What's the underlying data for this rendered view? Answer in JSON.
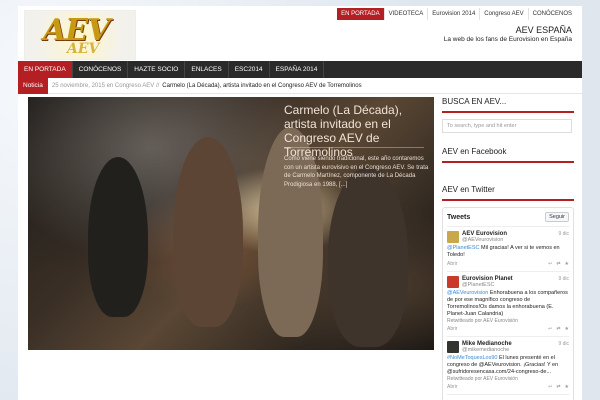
{
  "topnav": [
    "EN PORTADA",
    "VIDEOTECA",
    "Eurovision 2014",
    "Congreso AEV",
    "CONÓCENOS"
  ],
  "logo": {
    "text": "AEV",
    "subtext": "AEV"
  },
  "site": {
    "title": "AEV ESPAÑA",
    "description": "La web de los fans de Eurovision en España"
  },
  "mainnav": [
    "EN PORTADA",
    "CONÓCENOS",
    "HAZTE SOCIO",
    "ENLACES",
    "ESC2014",
    "ESPAÑA 2014"
  ],
  "ticker": {
    "label": "Noticia",
    "meta": "25 noviembre, 2015 en Congreso AEV //",
    "title": "Carmelo (La Década), artista invitado en el Congreso AEV de Torremolinos"
  },
  "feature": {
    "title": "Carmelo (La Década), artista invitado en el Congreso AEV de Torremolinos",
    "excerpt": "Como viene siendo tradicional, este año contaremos con un artista eurovisivo en el Congreso AEV. Se trata de Carmelo Martínez, componente de La Década Prodigiosa en 1988, [...]"
  },
  "sidebar": {
    "search_title": "BUSCA EN AEV...",
    "search_placeholder": "To search, type and hit enter",
    "facebook_title": "AEV en Facebook",
    "twitter_title": "AEV en Twitter"
  },
  "twitter": {
    "header": "Tweets",
    "follow_label": "Seguir",
    "tweets": [
      {
        "name": "AEV Eurovision",
        "handle": "@AEVeurovision",
        "date": "9 dic",
        "mention": "@PlanetESC",
        "text": " Mil gracias! A ver si te vemos en Toledo!",
        "retweet": "",
        "action": "Abrir"
      },
      {
        "name": "Eurovision Planet",
        "handle": "@PlanetESC",
        "date": "9 dic",
        "mention": "@AEVeurovision",
        "text": "Enhorabuena a los compañeros de  por ese magnífico congreso de Torremolinos!Os damos la enhorabuena (E. Planet-Juan Calandria)",
        "retweet": "Retwitteado por AEV Eurovisión",
        "action": "Abrir"
      },
      {
        "name": "Mike Medianoche",
        "handle": "@mikemedianoche",
        "date": "9 dic",
        "mention": "#NoMeToquesLos90",
        "text": "El lunes presenté  en el congreso de @AEVeurovision. ¡Gracias! Y en @sufridoresencasa.com/24-congreso-de...",
        "retweet": "Retwitteado por AEV Eurovisión",
        "action": "Abrir"
      }
    ]
  },
  "colors": {
    "accent": "#b41f24",
    "nav_bg": "#2a2a2a"
  }
}
